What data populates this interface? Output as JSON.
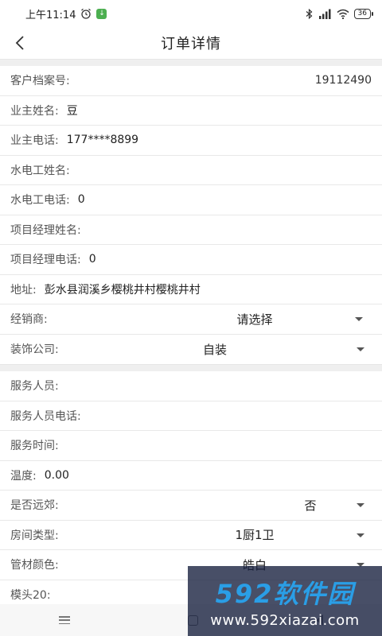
{
  "status_bar": {
    "time": "上午11:14",
    "battery": "36"
  },
  "header": {
    "title": "订单详情"
  },
  "section1": [
    {
      "label": "客户档案号:",
      "value": "19112490",
      "align": "right"
    },
    {
      "label": "业主姓名:",
      "value": "豆"
    },
    {
      "label": "业主电话:",
      "value": "177****8899"
    },
    {
      "label": "水电工姓名:",
      "value": ""
    },
    {
      "label": "水电工电话:",
      "value": "0"
    },
    {
      "label": "项目经理姓名:",
      "value": ""
    },
    {
      "label": "项目经理电话:",
      "value": "0"
    },
    {
      "label": "地址:",
      "value": "彭水县润溪乡樱桃井村樱桃井村"
    }
  ],
  "selects1": {
    "dealer": {
      "label": "经销商:",
      "value": "请选择"
    },
    "company": {
      "label": "装饰公司:",
      "value": "自装"
    }
  },
  "section2": [
    {
      "label": "服务人员:",
      "value": ""
    },
    {
      "label": "服务人员电话:",
      "value": ""
    },
    {
      "label": "服务时间:",
      "value": ""
    },
    {
      "label": "温度:",
      "value": "0.00"
    }
  ],
  "selects2": {
    "suburb": {
      "label": "是否远郊:",
      "value": "否"
    },
    "room": {
      "label": "房间类型:",
      "value": "1厨1卫"
    },
    "pipe": {
      "label": "管材颜色:",
      "value": "皓白"
    }
  },
  "last_row": {
    "label": "模头20:",
    "value": ""
  },
  "watermark": {
    "brand": "592软件园",
    "url": "www.592xiazai.com"
  }
}
